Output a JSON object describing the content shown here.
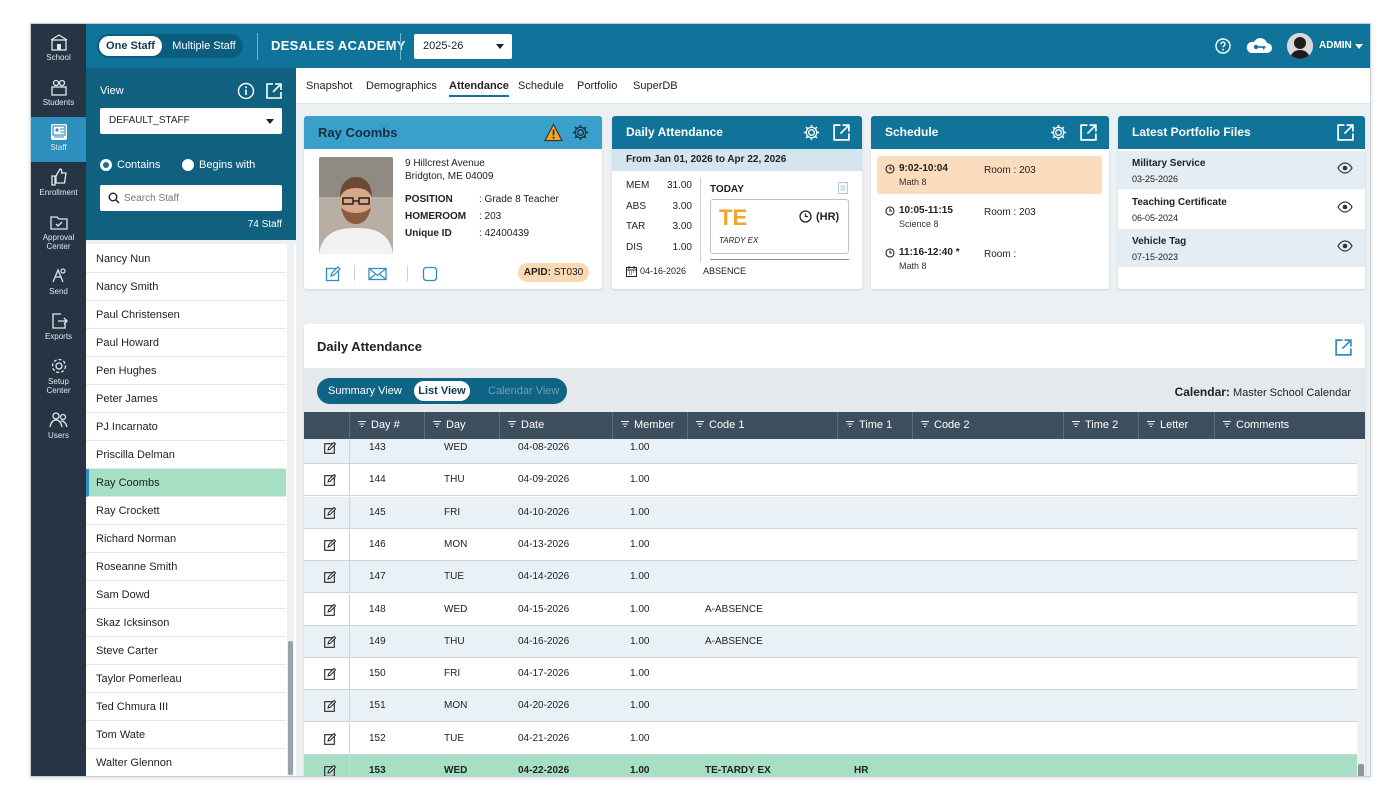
{
  "rail": [
    {
      "label": "School",
      "icon": "school-icon"
    },
    {
      "label": "Students",
      "icon": "students-icon"
    },
    {
      "label": "Staff",
      "icon": "staff-icon"
    },
    {
      "label": "Enrollment",
      "icon": "enrollment-icon"
    },
    {
      "label_line1": "Approval",
      "label_line2": "Center",
      "icon": "approval-icon"
    },
    {
      "label": "Send",
      "icon": "send-icon"
    },
    {
      "label": "Exports",
      "icon": "exports-icon"
    },
    {
      "label_line1": "Setup",
      "label_line2": "Center",
      "icon": "setup-icon"
    },
    {
      "label": "Users",
      "icon": "users-icon"
    }
  ],
  "topbar": {
    "one_staff": "One Staff",
    "multiple_staff": "Multiple Staff",
    "school": "DESALES ACADEMY",
    "year": "2025-26",
    "user": "ADMIN"
  },
  "sidebar": {
    "view_label": "View",
    "view_value": "DEFAULT_STAFF",
    "contains": "Contains",
    "begins_with": "Begins with",
    "search_placeholder": "Search Staff",
    "count": "74 Staff",
    "staff": [
      "Nancy Nun",
      "Nancy Smith",
      "Paul Christensen",
      "Paul Howard",
      "Pen Hughes",
      "Peter James",
      "PJ Incarnato",
      "Priscilla Delman",
      "Ray Coombs",
      "Ray Crockett",
      "Richard Norman",
      "Roseanne Smith",
      "Sam Dowd",
      "Skaz Icksinson",
      "Steve Carter",
      "Taylor Pomerleau",
      "Ted Chmura III",
      "Tom Wate",
      "Walter Glennon"
    ],
    "selected": "Ray Coombs"
  },
  "tabs": [
    "Snapshot",
    "Demographics",
    "Attendance",
    "Schedule",
    "Portfolio",
    "SuperDB"
  ],
  "active_tab": "Attendance",
  "profile": {
    "name": "Ray Coombs",
    "address1": "9 Hillcrest Avenue",
    "address2": "Bridgton, ME 04009",
    "position_label": "POSITION",
    "position": ": Grade 8 Teacher",
    "homeroom_label": "HOMEROOM",
    "homeroom": ": 203",
    "uid_label": "Unique ID",
    "uid": ": 42400439",
    "apid_label": "APID:",
    "apid": "ST030"
  },
  "daily_attendance": {
    "title": "Daily Attendance",
    "range": "From Jan 01, 2026 to Apr 22, 2026",
    "stats": [
      {
        "label": "MEM",
        "value": "31.00"
      },
      {
        "label": "ABS",
        "value": "3.00"
      },
      {
        "label": "TAR",
        "value": "3.00"
      },
      {
        "label": "DIS",
        "value": "1.00"
      }
    ],
    "today_label": "TODAY",
    "today_code": "TE",
    "today_desc": "TARDY EX",
    "today_hr": "(HR)",
    "last_date": "04-16-2026",
    "last_code": "ABSENCE"
  },
  "schedule": {
    "title": "Schedule",
    "items": [
      {
        "time": "9:02-10:04",
        "course": "Math 8",
        "room": "Room : 203"
      },
      {
        "time": "10:05-11:15",
        "course": "Science 8",
        "room": "Room : 203"
      },
      {
        "time": "11:16-12:40 *",
        "course": "Math 8",
        "room": "Room :"
      }
    ]
  },
  "portfolio": {
    "title": "Latest Portfolio Files",
    "files": [
      {
        "name": "Military Service",
        "date": "03-25-2026"
      },
      {
        "name": "Teaching Certificate",
        "date": "06-05-2024"
      },
      {
        "name": "Vehicle Tag",
        "date": "07-15-2023"
      }
    ]
  },
  "attendance_panel": {
    "title": "Daily Attendance",
    "views": [
      "Summary View",
      "List View",
      "Calendar View"
    ],
    "active_view": "List View",
    "calendar_label": "Calendar:",
    "calendar_value": "Master School Calendar",
    "columns": [
      "Day #",
      "Day",
      "Date",
      "Member",
      "Code 1",
      "Time 1",
      "Code 2",
      "Time 2",
      "Letter",
      "Comments"
    ],
    "rows": [
      {
        "day_no": "143",
        "day": "WED",
        "date": "04-08-2026",
        "member": "1.00",
        "code1": "",
        "time1": ""
      },
      {
        "day_no": "144",
        "day": "THU",
        "date": "04-09-2026",
        "member": "1.00",
        "code1": "",
        "time1": ""
      },
      {
        "day_no": "145",
        "day": "FRI",
        "date": "04-10-2026",
        "member": "1.00",
        "code1": "",
        "time1": ""
      },
      {
        "day_no": "146",
        "day": "MON",
        "date": "04-13-2026",
        "member": "1.00",
        "code1": "",
        "time1": ""
      },
      {
        "day_no": "147",
        "day": "TUE",
        "date": "04-14-2026",
        "member": "1.00",
        "code1": "",
        "time1": ""
      },
      {
        "day_no": "148",
        "day": "WED",
        "date": "04-15-2026",
        "member": "1.00",
        "code1": "A-ABSENCE",
        "time1": ""
      },
      {
        "day_no": "149",
        "day": "THU",
        "date": "04-16-2026",
        "member": "1.00",
        "code1": "A-ABSENCE",
        "time1": ""
      },
      {
        "day_no": "150",
        "day": "FRI",
        "date": "04-17-2026",
        "member": "1.00",
        "code1": "",
        "time1": ""
      },
      {
        "day_no": "151",
        "day": "MON",
        "date": "04-20-2026",
        "member": "1.00",
        "code1": "",
        "time1": ""
      },
      {
        "day_no": "152",
        "day": "TUE",
        "date": "04-21-2026",
        "member": "1.00",
        "code1": "",
        "time1": ""
      },
      {
        "day_no": "153",
        "day": "WED",
        "date": "04-22-2026",
        "member": "1.00",
        "code1": "TE-TARDY EX",
        "time1": "HR"
      }
    ],
    "selected_row": "153"
  },
  "colors": {
    "topbar": "#0f739a",
    "rail": "#263544",
    "selected": "#a6dfc3",
    "tardy": "#f0a52a"
  }
}
